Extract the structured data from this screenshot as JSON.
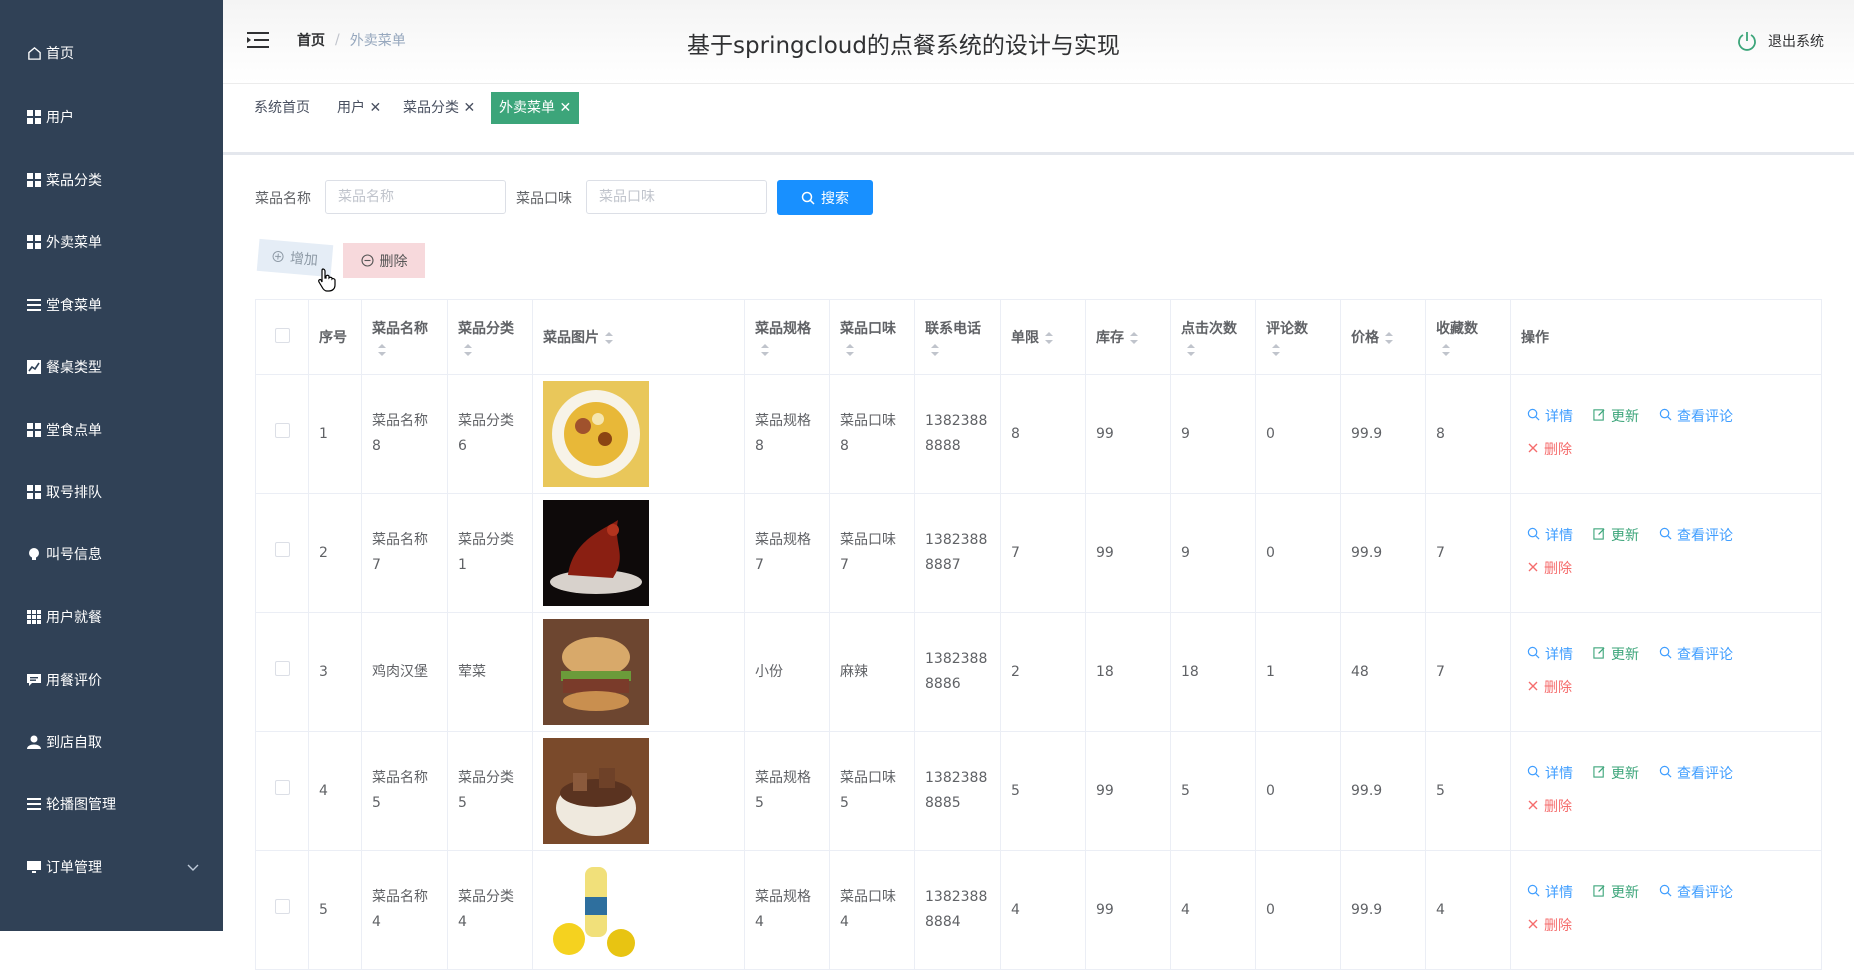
{
  "sidebar": {
    "items": [
      {
        "label": "首页",
        "icon": "home-icon"
      },
      {
        "label": "用户",
        "icon": "grid-icon"
      },
      {
        "label": "菜品分类",
        "icon": "grid-icon"
      },
      {
        "label": "外卖菜单",
        "icon": "grid-icon"
      },
      {
        "label": "堂食菜单",
        "icon": "list-icon"
      },
      {
        "label": "餐桌类型",
        "icon": "chart-icon"
      },
      {
        "label": "堂食点单",
        "icon": "grid-icon"
      },
      {
        "label": "取号排队",
        "icon": "grid-icon"
      },
      {
        "label": "叫号信息",
        "icon": "bulb-icon"
      },
      {
        "label": "用户就餐",
        "icon": "apps-icon"
      },
      {
        "label": "用餐评价",
        "icon": "comment-icon"
      },
      {
        "label": "到店自取",
        "icon": "user-icon"
      },
      {
        "label": "轮播图管理",
        "icon": "list-icon"
      },
      {
        "label": "订单管理",
        "icon": "monitor-icon"
      }
    ]
  },
  "header": {
    "breadcrumb_home": "首页",
    "breadcrumb_sep": "/",
    "breadcrumb_current": "外卖菜单",
    "title": "基于springcloud的点餐系统的设计与实现",
    "logout_label": "退出系统"
  },
  "tags": [
    {
      "label": "系统首页"
    },
    {
      "label": "用户 ✕"
    },
    {
      "label": "菜品分类 ✕"
    },
    {
      "label": "外卖菜单 ✕"
    }
  ],
  "search": {
    "name_label": "菜品名称",
    "name_placeholder": "菜品名称",
    "taste_label": "菜品口味",
    "taste_placeholder": "菜品口味",
    "search_button": "搜索"
  },
  "actions": {
    "add_label": "增加",
    "delete_label": "删除"
  },
  "table": {
    "columns": [
      "序号",
      "菜品名称",
      "菜品分类",
      "菜品图片",
      "菜品规格",
      "菜品口味",
      "联系电话",
      "单限",
      "库存",
      "点击次数",
      "评论数",
      "价格",
      "收藏数",
      "操作"
    ],
    "op_labels": {
      "detail": "详情",
      "update": "更新",
      "review": "查看评论",
      "remove": "删除"
    },
    "rows": [
      {
        "index": "1",
        "name": "菜品名称\n8",
        "category": "菜品分类\n6",
        "spec": "菜品规格\n8",
        "taste": "菜品口味\n8",
        "phone": "1382388\n8888",
        "limit": "8",
        "stock": "99",
        "clicks": "9",
        "comments": "0",
        "price": "99.9",
        "favorites": "8",
        "img": "fried-egg-dish"
      },
      {
        "index": "2",
        "name": "菜品名称\n7",
        "category": "菜品分类\n1",
        "spec": "菜品规格\n7",
        "taste": "菜品口味\n7",
        "phone": "1382388\n8887",
        "limit": "7",
        "stock": "99",
        "clicks": "9",
        "comments": "0",
        "price": "99.9",
        "favorites": "7",
        "img": "braised-duck"
      },
      {
        "index": "3",
        "name": "鸡肉汉堡",
        "category": "荤菜",
        "spec": "小份",
        "taste": "麻辣",
        "phone": "1382388\n8886",
        "limit": "2",
        "stock": "18",
        "clicks": "18",
        "comments": "1",
        "price": "48",
        "favorites": "7",
        "img": "chicken-burger"
      },
      {
        "index": "4",
        "name": "菜品名称\n5",
        "category": "菜品分类\n5",
        "spec": "菜品规格\n5",
        "taste": "菜品口味\n5",
        "phone": "1382388\n8885",
        "limit": "5",
        "stock": "99",
        "clicks": "5",
        "comments": "0",
        "price": "99.9",
        "favorites": "5",
        "img": "braised-pork-bowl"
      },
      {
        "index": "5",
        "name": "菜品名称\n4",
        "category": "菜品分类\n4",
        "spec": "菜品规格\n4",
        "taste": "菜品口味\n4",
        "phone": "1382388\n8884",
        "limit": "4",
        "stock": "99",
        "clicks": "4",
        "comments": "0",
        "price": "99.9",
        "favorites": "4",
        "img": "lemon-juice"
      }
    ]
  },
  "colors": {
    "sidebar_bg": "#304156",
    "primary": "#1890ff",
    "success": "#3ca57a",
    "danger": "#f56c6c",
    "link": "#409eff"
  }
}
